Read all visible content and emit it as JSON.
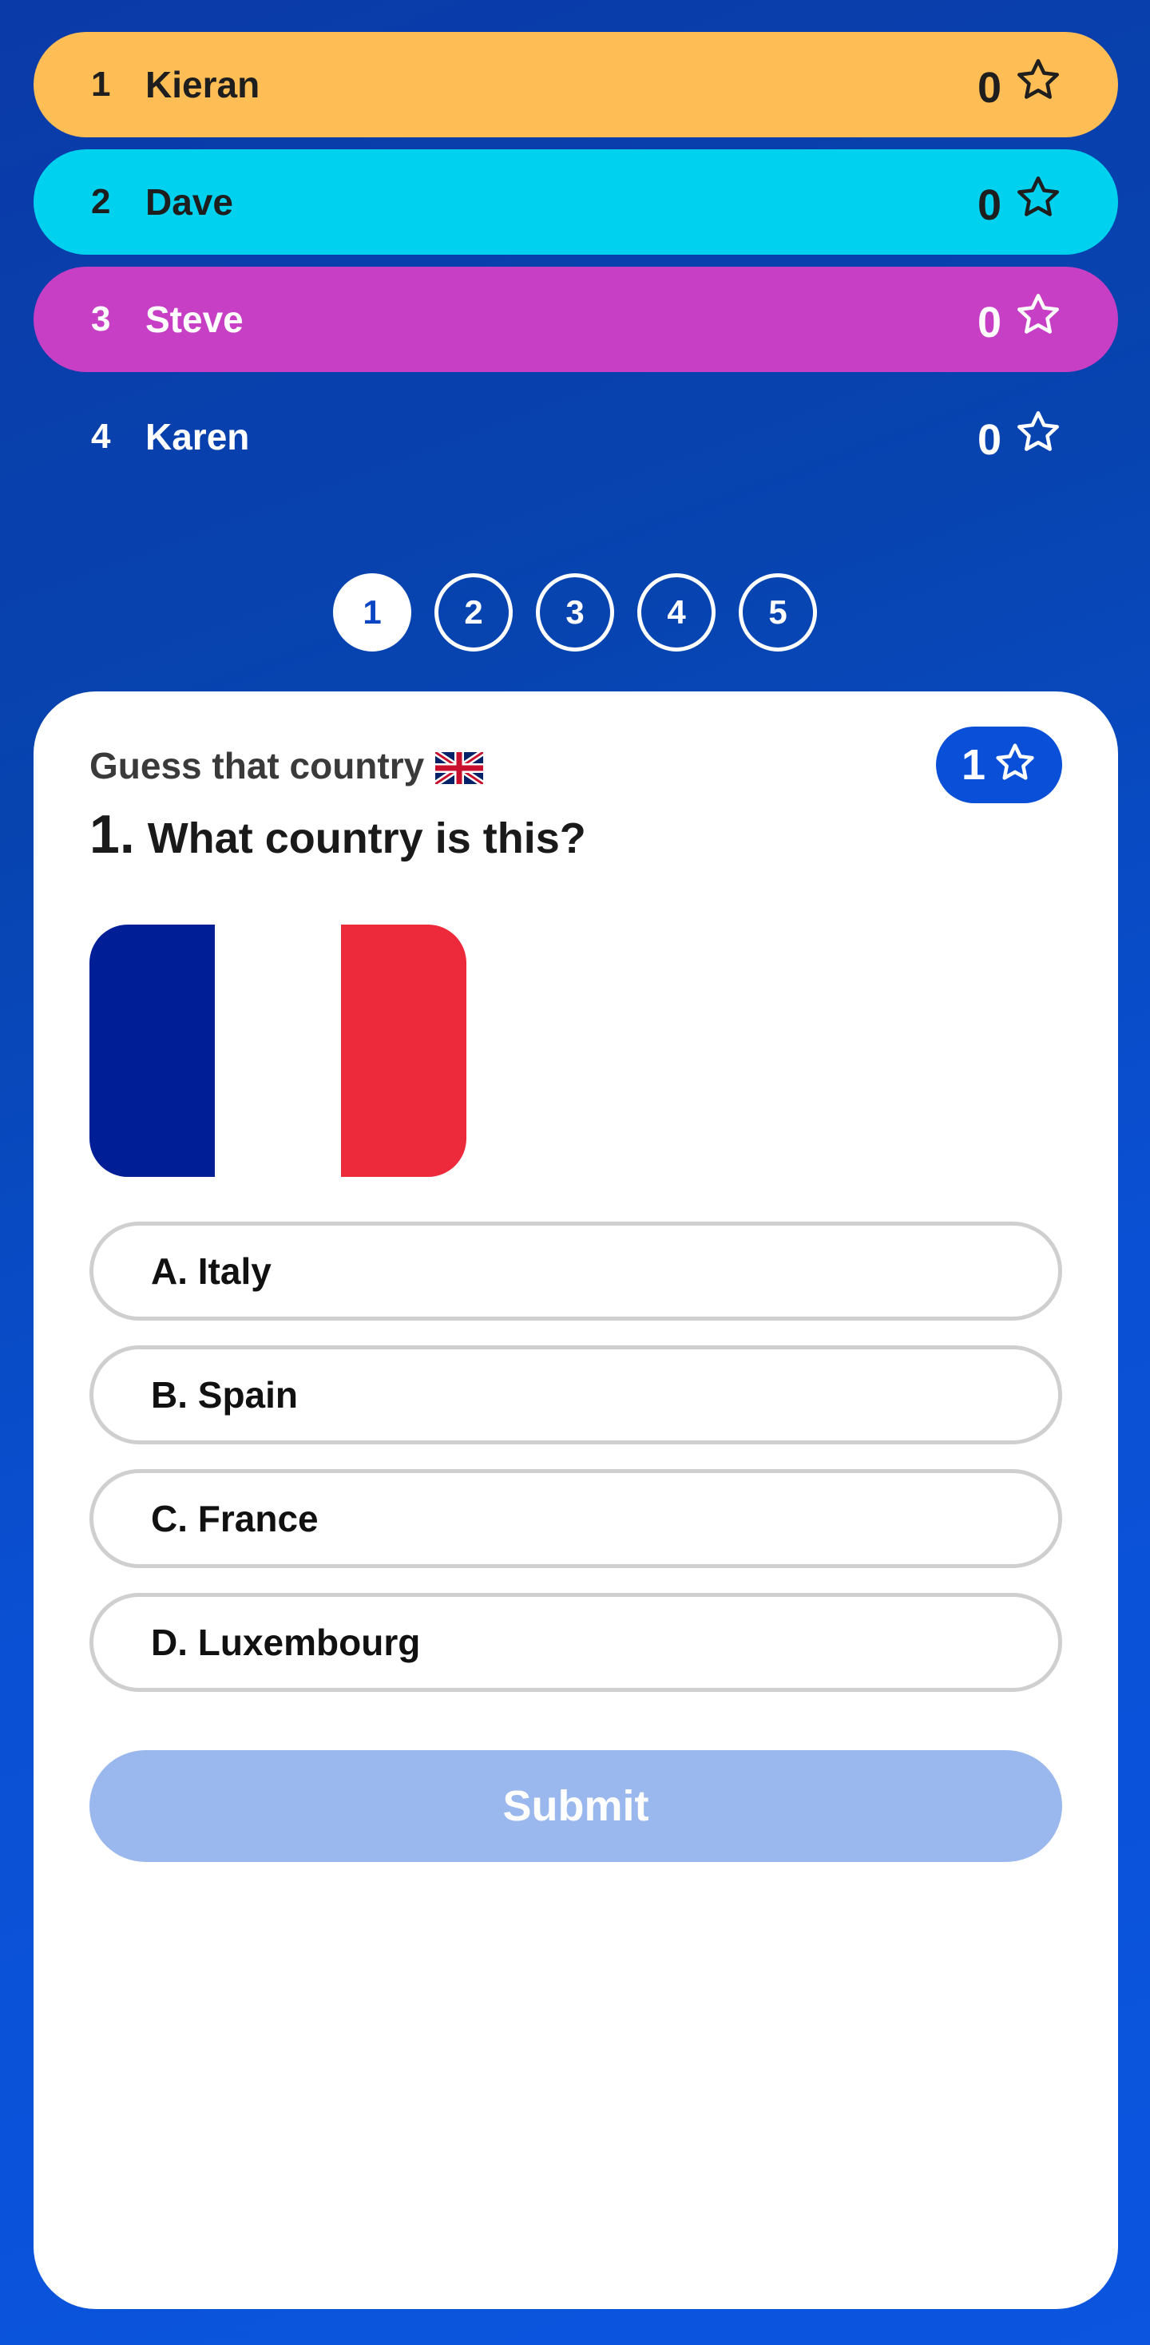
{
  "players": [
    {
      "rank": "1",
      "name": "Kieran",
      "score": "0",
      "bg": "#ffbd55",
      "text": "#1e1e1e",
      "star_icon": "star-outline-icon"
    },
    {
      "rank": "2",
      "name": "Dave",
      "score": "0",
      "bg": "#00d1ef",
      "text": "#1e1e1e",
      "star_icon": "star-outline-icon"
    },
    {
      "rank": "3",
      "name": "Steve",
      "score": "0",
      "bg": "#c73fc4",
      "text": "#ffffff",
      "star_icon": "star-outline-icon"
    },
    {
      "rank": "4",
      "name": "Karen",
      "score": "0",
      "bg": "transparent",
      "text": "#ffffff",
      "star_icon": "star-outline-icon"
    }
  ],
  "pager": {
    "pages": [
      "1",
      "2",
      "3",
      "4",
      "5"
    ],
    "active": "1"
  },
  "quiz": {
    "subtitle": "Guess that country",
    "subtitle_icon": "uk-flag-icon",
    "points": "1",
    "points_icon": "star-outline-icon",
    "question_number": "1.",
    "question_text": "What country is this?",
    "flag_image": {
      "depicts": "flag-of-france",
      "colors": [
        "#001f96",
        "#ffffff",
        "#ec2a3b"
      ]
    },
    "answers": [
      {
        "label": "A. Italy"
      },
      {
        "label": "B. Spain"
      },
      {
        "label": "C. France"
      },
      {
        "label": "D. Luxembourg"
      }
    ],
    "submit_label": "Submit"
  },
  "colors": {
    "accent": "#0a4fd8",
    "submit_disabled": "#9bb8ee",
    "option_border": "#cfcfcf"
  }
}
